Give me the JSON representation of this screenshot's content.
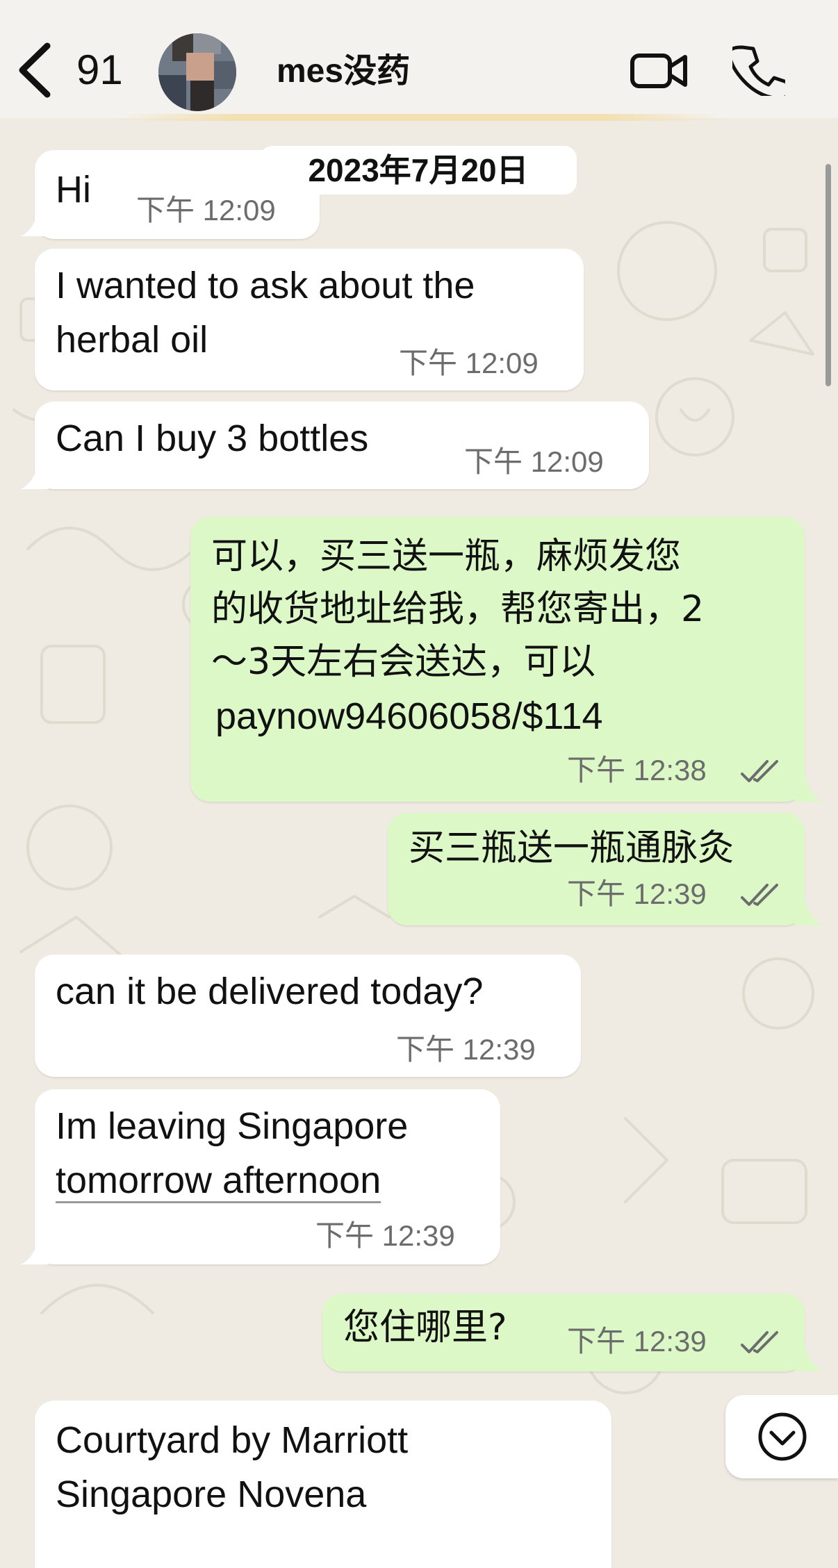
{
  "header": {
    "unread_count": "91",
    "contact_name": "mes没药"
  },
  "date_chip": "2023年7月20日",
  "messages": [
    {
      "direction": "in",
      "lines": [
        "Hi"
      ],
      "time": "下午 12:09"
    },
    {
      "direction": "in",
      "lines": [
        "I wanted to ask about the",
        "herbal oil"
      ],
      "time": "下午 12:09"
    },
    {
      "direction": "in",
      "lines": [
        "Can I buy 3 bottles"
      ],
      "time": "下午 12:09"
    },
    {
      "direction": "out",
      "lines": [
        "可以，买三送一瓶，麻烦发您",
        "的收货地址给我，帮您寄出，2",
        "～3天左右会送达，可以",
        "paynow94606058/$114"
      ],
      "time": "下午 12:38",
      "status": "read"
    },
    {
      "direction": "out",
      "lines": [
        "买三瓶送一瓶通脉灸"
      ],
      "time": "下午 12:39",
      "status": "read"
    },
    {
      "direction": "in",
      "lines": [
        "can it be delivered today?"
      ],
      "time": "下午 12:39"
    },
    {
      "direction": "in",
      "lines": [
        "Im leaving Singapore",
        "tomorrow afternoon"
      ],
      "time": "下午 12:39"
    },
    {
      "direction": "out",
      "lines": [
        "您住哪里?"
      ],
      "time": "下午 12:39",
      "status": "read"
    },
    {
      "direction": "in",
      "lines": [
        "Courtyard by Marriott",
        "Singapore Novena"
      ],
      "time": ""
    }
  ],
  "icons": {
    "back": "chevron-left-icon",
    "video": "video-camera-icon",
    "phone": "phone-icon",
    "read_status": "double-check-icon",
    "scroll_down": "chevron-down-circle-icon"
  },
  "colors": {
    "incoming_bubble": "#ffffff",
    "outgoing_bubble": "#dbf8c6",
    "wallpaper": "#efeae2",
    "header": "#f3f2ee"
  }
}
